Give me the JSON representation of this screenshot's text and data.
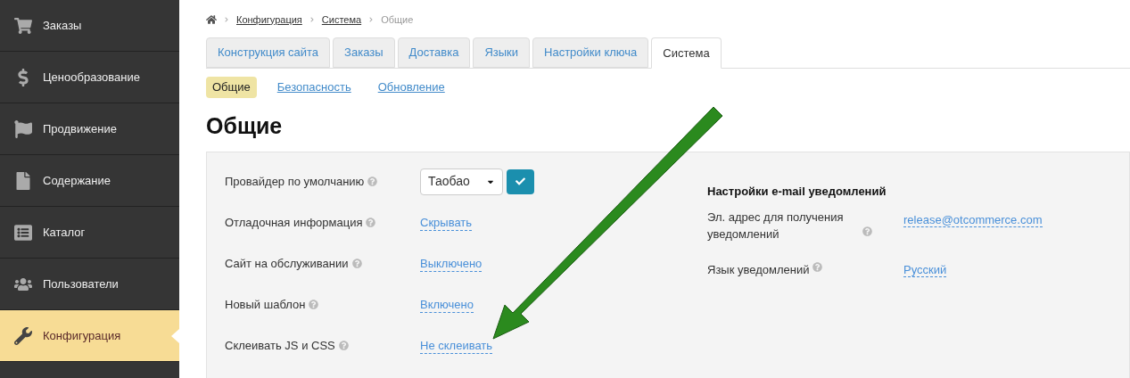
{
  "sidebar": {
    "items": [
      {
        "label": "Заказы",
        "selected": false
      },
      {
        "label": "Ценообразование",
        "selected": false
      },
      {
        "label": "Продвижение",
        "selected": false
      },
      {
        "label": "Содержание",
        "selected": false
      },
      {
        "label": "Каталог",
        "selected": false
      },
      {
        "label": "Пользователи",
        "selected": false
      },
      {
        "label": "Конфигурация",
        "selected": true
      }
    ]
  },
  "breadcrumb": [
    "Конфигурация",
    "Система",
    "Общие"
  ],
  "tabs": [
    {
      "label": "Конструкция сайта",
      "selected": false
    },
    {
      "label": "Заказы",
      "selected": false
    },
    {
      "label": "Доставка",
      "selected": false
    },
    {
      "label": "Языки",
      "selected": false
    },
    {
      "label": "Настройки ключа",
      "selected": false
    },
    {
      "label": "Система",
      "selected": true
    }
  ],
  "subtabs": [
    {
      "label": "Общие",
      "selected": true
    },
    {
      "label": "Безопасность",
      "selected": false
    },
    {
      "label": "Обновление",
      "selected": false
    }
  ],
  "heading": "Общие",
  "settings": [
    {
      "label": "Провайдер по умолчанию",
      "kind": "select",
      "value": "Таобао"
    },
    {
      "label": "Отладочная информация",
      "kind": "link",
      "value": "Скрывать"
    },
    {
      "label": "Сайт на обслуживании",
      "kind": "link",
      "value": "Выключено"
    },
    {
      "label": "Новый шаблон",
      "kind": "link",
      "value": "Включено"
    },
    {
      "label": "Склеивать JS и CSS",
      "kind": "link",
      "value": "Не склеивать"
    }
  ],
  "email_settings": {
    "title": "Настройки e-mail уведомлений",
    "rows": [
      {
        "label": "Эл. адрес для получения уведомлений",
        "value": "release@otcommerce.com"
      },
      {
        "label": "Язык уведомлений",
        "value": "Русский"
      }
    ]
  }
}
